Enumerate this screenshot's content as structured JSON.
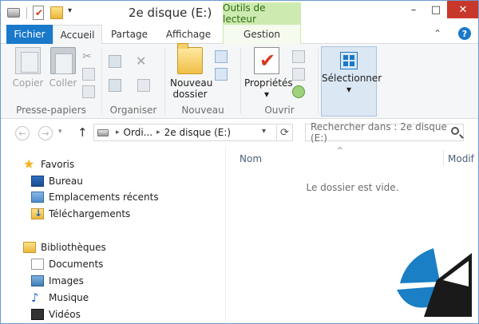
{
  "window": {
    "title": "2e disque (E:)",
    "context_tab_label": "Outils de lecteur",
    "controls": {
      "minimize": "–",
      "maximize": "□",
      "close": "✕"
    },
    "quick_access_dropdown": "▾"
  },
  "tabs": {
    "fichier": "Fichier",
    "accueil": "Accueil",
    "partage": "Partage",
    "affichage": "Affichage",
    "gestion": "Gestion",
    "collapse": "⌃",
    "help": "?"
  },
  "ribbon": {
    "presse_papiers": {
      "label": "Presse-papiers",
      "copier": "Copier",
      "coller": "Coller"
    },
    "organiser": {
      "label": "Organiser"
    },
    "nouveau": {
      "label": "Nouveau",
      "nouveau_dossier_line1": "Nouveau",
      "nouveau_dossier_line2": "dossier"
    },
    "ouvrir": {
      "label": "Ouvrir",
      "proprietes": "Propriétés",
      "dropdown": "▾"
    },
    "selectionner": {
      "label": "Sélectionner",
      "dropdown": "▾"
    }
  },
  "navigation": {
    "back": "←",
    "forward": "→",
    "recent": "▾",
    "up": "↑",
    "breadcrumb": [
      "Ordi...",
      "2e disque (E:)"
    ],
    "breadcrumb_chevron": "▸",
    "address_dropdown": "▾",
    "refresh": "⟳",
    "search_placeholder": "Rechercher dans : 2e disque (E:)"
  },
  "sidebar": {
    "favoris": "Favoris",
    "favoris_items": [
      "Bureau",
      "Emplacements récents",
      "Téléchargements"
    ],
    "bibliotheques": "Bibliothèques",
    "bibliotheques_items": [
      "Documents",
      "Images",
      "Musique",
      "Vidéos"
    ]
  },
  "file_list": {
    "sort_indicator": "^",
    "columns": [
      "Nom",
      "Modif"
    ],
    "empty_message": "Le dossier est vide."
  },
  "colors": {
    "accent": "#1979ca",
    "context_tab": "#cdebb0",
    "close_button": "#c7382b",
    "watermark": "#1a7fc5"
  }
}
